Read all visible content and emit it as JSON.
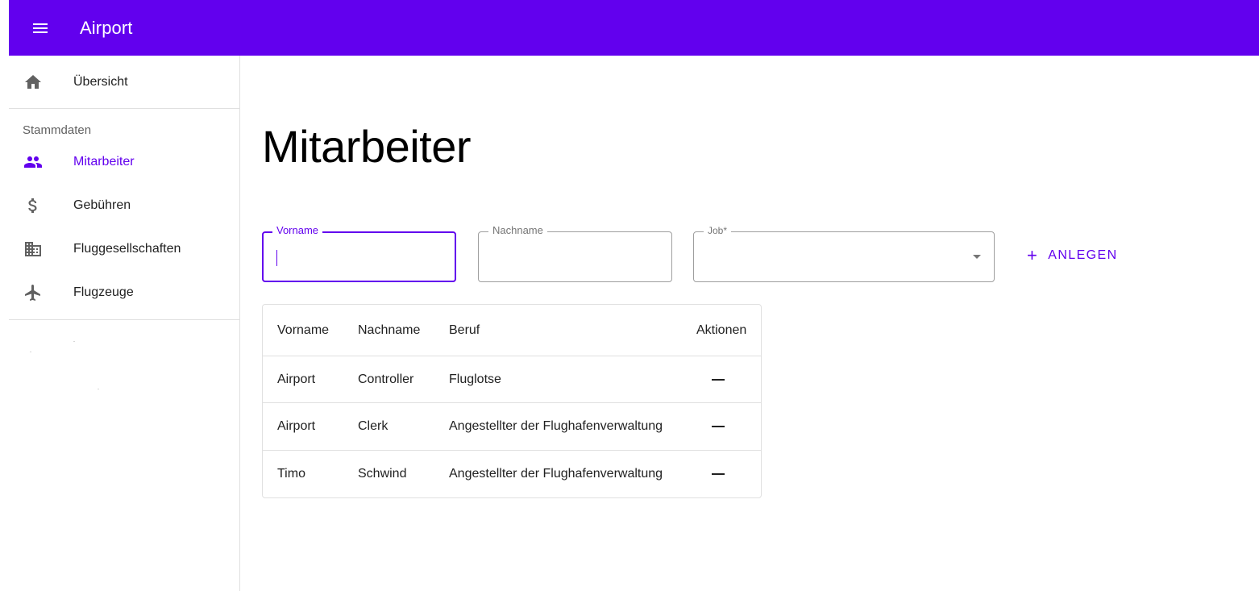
{
  "appbar": {
    "title": "Airport",
    "color": "#6200ee",
    "menu_icon": "menu-icon"
  },
  "drawer": {
    "overview": {
      "label": "Übersicht",
      "icon": "home-icon"
    },
    "section_title": "Stammdaten",
    "items": [
      {
        "label": "Mitarbeiter",
        "icon": "people-icon",
        "active": true
      },
      {
        "label": "Gebühren",
        "icon": "dollar-icon",
        "active": false
      },
      {
        "label": "Fluggesellschaften",
        "icon": "building-icon",
        "active": false
      },
      {
        "label": "Flugzeuge",
        "icon": "airplane-icon",
        "active": false
      }
    ]
  },
  "main": {
    "title": "Mitarbeiter",
    "form": {
      "firstname_label": "Vorname",
      "firstname_value": "",
      "lastname_label": "Nachname",
      "lastname_value": "",
      "job_label": "Job*",
      "job_value": "",
      "create_button": "ANLEGEN",
      "create_icon": "plus-icon"
    },
    "table": {
      "columns": [
        "Vorname",
        "Nachname",
        "Beruf",
        "Aktionen"
      ],
      "rows": [
        {
          "firstname": "Airport",
          "lastname": "Controller",
          "job": "Fluglotse",
          "action_icon": "minus-icon"
        },
        {
          "firstname": "Airport",
          "lastname": "Clerk",
          "job": "Angestellter der Flughafenverwaltung",
          "action_icon": "minus-icon"
        },
        {
          "firstname": "Timo",
          "lastname": "Schwind",
          "job": "Angestellter der Flughafenverwaltung",
          "action_icon": "minus-icon"
        }
      ]
    }
  },
  "colors": {
    "primary": "#6200ee",
    "divider": "#e0e0e0",
    "icon_inactive": "#616161"
  }
}
